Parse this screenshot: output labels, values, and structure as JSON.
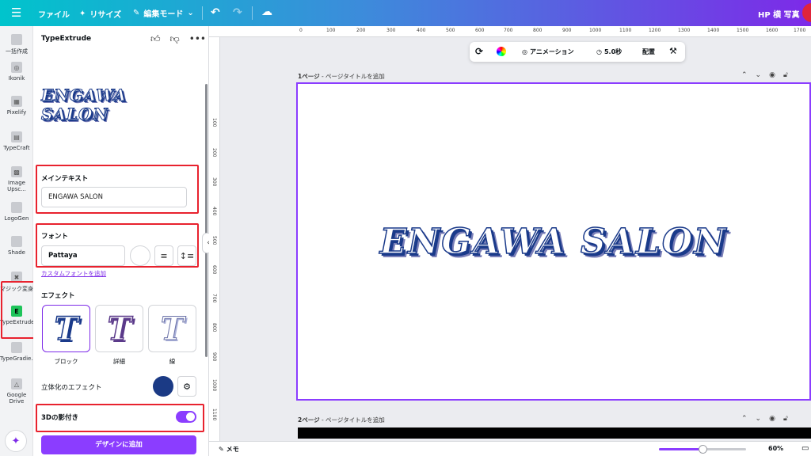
{
  "topbar": {
    "file_label": "ファイル",
    "resize_label": "リサイズ",
    "edit_mode_label": "編集モード",
    "user_name": "HP 横 写真"
  },
  "rail": {
    "items": [
      {
        "label": "一括作成"
      },
      {
        "label": "Ikonik"
      },
      {
        "label": "Pixelify"
      },
      {
        "label": "TypeCraft"
      },
      {
        "label": "Image Upsc..."
      },
      {
        "label": "LogoGen"
      },
      {
        "label": "Shade"
      },
      {
        "label": "マジック変身"
      },
      {
        "label": "TypeExtrude",
        "icon_letter": "E"
      },
      {
        "label": "TypeGradie..."
      },
      {
        "label": "Google Drive"
      }
    ]
  },
  "panel": {
    "title": "TypeExtrude",
    "preview_text": "ENGAWA SALON",
    "main_text_label": "メインテキスト",
    "main_text_value": "ENGAWA SALON",
    "font_label": "フォント",
    "font_value": "Pattaya",
    "custom_font_link": "カスタムフォントを追加",
    "effect_label": "エフェクト",
    "effects": [
      {
        "label": "ブロック",
        "glyph": "T",
        "selected": true
      },
      {
        "label": "詳細",
        "glyph": "T",
        "selected": false
      },
      {
        "label": "線",
        "glyph": "T",
        "selected": false
      }
    ],
    "depth_effect_label": "立体化のエフェクト",
    "depth_color": "#1b3a85",
    "shadow_label": "3Dの影付き",
    "shadow_enabled": true,
    "add_button_label": "デザインに追加"
  },
  "ruler": {
    "top": [
      "0",
      "100",
      "200",
      "300",
      "400",
      "500",
      "600",
      "700",
      "800",
      "900",
      "1000",
      "1100",
      "1200",
      "1300",
      "1400",
      "1500",
      "1600",
      "1700"
    ],
    "left": [
      "100",
      "200",
      "300",
      "400",
      "500",
      "600",
      "700",
      "800",
      "900",
      "1000",
      "1100"
    ]
  },
  "floating_toolbar": {
    "animation_label": "アニメーション",
    "duration_label": "5.0秒",
    "arrange_label": "配置"
  },
  "pages": [
    {
      "number_label": "1ページ",
      "title_placeholder": "- ページタイトルを追加",
      "canvas_text": "ENGAWA SALON"
    },
    {
      "number_label": "2ページ",
      "title_placeholder": "- ページタイトルを追加"
    }
  ],
  "bottombar": {
    "memo_label": "メモ",
    "zoom_value": "60%",
    "zoom_fraction": 0.6
  },
  "colors": {
    "accent": "#8b3dff",
    "highlight_box": "#e8222e",
    "text_outline": "#1a3a8a"
  }
}
